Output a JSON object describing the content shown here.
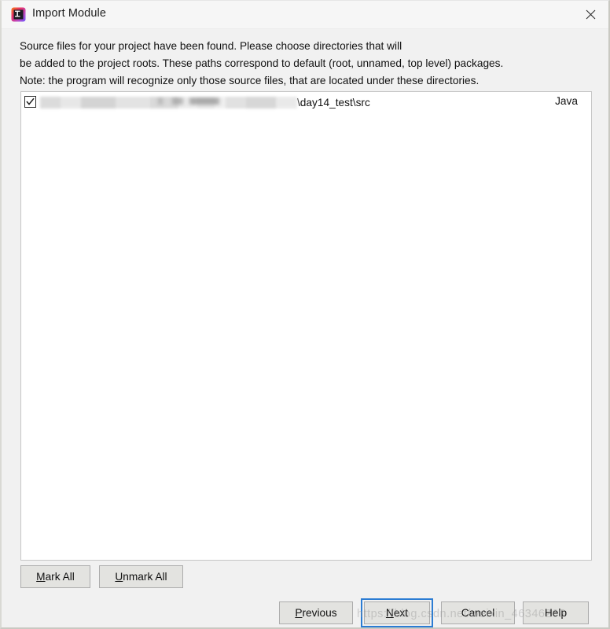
{
  "window": {
    "title": "Import Module",
    "app_icon": "intellij-idea-icon",
    "close_icon": "close-icon"
  },
  "description": {
    "line1": "Source files for your project have been found. Please choose directories that will",
    "line2": "be added to the project roots. These paths correspond to default (root, unnamed, top level) packages.",
    "line3": "Note: the program will recognize only those source files, that are located under these directories."
  },
  "list": {
    "rows": [
      {
        "checked": true,
        "path_redacted": true,
        "path_visible": "\\day14_test\\src",
        "type": "Java"
      }
    ]
  },
  "mark_buttons": {
    "mark_all": {
      "prefix": "",
      "accel": "M",
      "suffix": "ark All"
    },
    "unmark_all": {
      "prefix": "",
      "accel": "U",
      "suffix": "nmark All"
    }
  },
  "nav_buttons": {
    "previous": {
      "prefix": "",
      "accel": "P",
      "suffix": "revious"
    },
    "next": {
      "prefix": "",
      "accel": "N",
      "suffix": "ext"
    },
    "cancel": {
      "label": "Cancel"
    },
    "help": {
      "label": "Help"
    }
  },
  "watermark": {
    "text": "https://blog.csdn.net/weixin_46346265"
  },
  "colors": {
    "dialog_background": "#f1f1f1",
    "titlebar_background": "#f6f6f6",
    "list_background": "#ffffff",
    "button_face": "#e3e3e0",
    "focus_ring": "#2b7cd3",
    "text": "#111111"
  }
}
